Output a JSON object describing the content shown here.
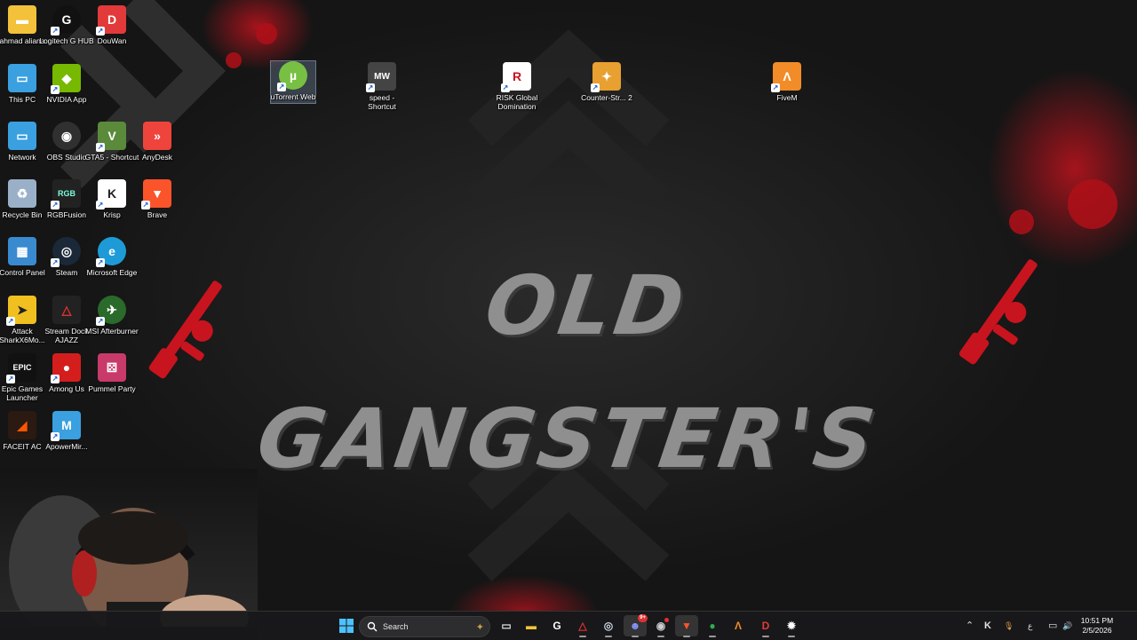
{
  "wallpaper": {
    "title": "OLD GANGSTER'S"
  },
  "desktop_icons": [
    {
      "label": "ahmad aliana",
      "icon": "folder-icon",
      "color": "#f3c13a"
    },
    {
      "label": "Logitech G HUB",
      "icon": "logitech-g-icon",
      "color": "#111111"
    },
    {
      "label": "DouWan",
      "icon": "douwan-icon",
      "color": "#e23a3a"
    },
    {
      "label": "This PC",
      "icon": "this-pc-icon",
      "color": "#3aa0e0"
    },
    {
      "label": "NVIDIA App",
      "icon": "nvidia-icon",
      "color": "#76b900"
    },
    {
      "label": "Network",
      "icon": "network-icon",
      "color": "#3aa0e0"
    },
    {
      "label": "OBS Studio",
      "icon": "obs-icon",
      "color": "#303030"
    },
    {
      "label": "GTA5 - Shortcut",
      "icon": "gta5-icon",
      "color": "#5a8a3a"
    },
    {
      "label": "AnyDesk",
      "icon": "anydesk-icon",
      "color": "#ef443b"
    },
    {
      "label": "Recycle Bin",
      "icon": "recycle-bin-icon",
      "color": "#9ab0c8"
    },
    {
      "label": "RGBFusion",
      "icon": "rgbfusion-icon",
      "color": "#222222"
    },
    {
      "label": "Krisp",
      "icon": "krisp-icon",
      "color": "#ffffff"
    },
    {
      "label": "Brave",
      "icon": "brave-icon",
      "color": "#fb542b"
    },
    {
      "label": "Control Panel",
      "icon": "control-panel-icon",
      "color": "#3a8ad0"
    },
    {
      "label": "Steam",
      "icon": "steam-icon",
      "color": "#1b2838"
    },
    {
      "label": "Microsoft Edge",
      "icon": "edge-icon",
      "color": "#1e9bd7"
    },
    {
      "label": "Attack SharkX6Mo...",
      "icon": "attack-shark-icon",
      "color": "#f0c020"
    },
    {
      "label": "Stream Dock AJAZZ",
      "icon": "stream-dock-icon",
      "color": "#222222"
    },
    {
      "label": "MSI Afterburner",
      "icon": "msi-afterburner-icon",
      "color": "#2a6a2a"
    },
    {
      "label": "Epic Games Launcher",
      "icon": "epic-games-icon",
      "color": "#111111"
    },
    {
      "label": "Among Us",
      "icon": "among-us-icon",
      "color": "#d41e1e"
    },
    {
      "label": "Pummel Party",
      "icon": "pummel-party-icon",
      "color": "#c83a6a"
    },
    {
      "label": "FACEIT AC",
      "icon": "faceit-icon",
      "color": "#ff5500"
    },
    {
      "label": "ApowerMir...",
      "icon": "apowermirror-icon",
      "color": "#3aa0e0"
    },
    {
      "label": "uTorrent Web",
      "icon": "utorrent-icon",
      "color": "#78c043"
    },
    {
      "label": "speed - Shortcut",
      "icon": "nfs-mw-icon",
      "color": "#444444"
    },
    {
      "label": "RISK Global Domination",
      "icon": "risk-icon",
      "color": "#ffffff"
    },
    {
      "label": "Counter-Str... 2",
      "icon": "counter-strike-icon",
      "color": "#e8a030"
    },
    {
      "label": "FiveM",
      "icon": "fivem-icon",
      "color": "#f28c28"
    }
  ],
  "icon_glyphs": [
    "▬",
    "G",
    "D",
    "▭",
    "◆",
    "▭",
    "◉",
    "V",
    "»",
    "♻",
    "RGB",
    "K",
    "▼",
    "▦",
    "◎",
    "e",
    "➤",
    "△",
    "✈",
    "EPIC",
    "●",
    "⚄",
    "◢",
    "M",
    "µ",
    "MW",
    "R",
    "✦",
    "Λ"
  ],
  "taskbar": {
    "search_placeholder": "Search",
    "apps": [
      {
        "name": "task-view",
        "glyph": "▭",
        "color": "#dddddd"
      },
      {
        "name": "file-explorer",
        "glyph": "▬",
        "color": "#f3c13a"
      },
      {
        "name": "logitech-g-hub",
        "glyph": "G",
        "color": "#ffffff"
      },
      {
        "name": "stream-dock",
        "glyph": "△",
        "color": "#e03030"
      },
      {
        "name": "steam",
        "glyph": "◎",
        "color": "#c7d5e0"
      },
      {
        "name": "discord",
        "glyph": "☻",
        "color": "#5865f2",
        "badge": "9+"
      },
      {
        "name": "obs-studio",
        "glyph": "◉",
        "color": "#cccccc"
      },
      {
        "name": "brave",
        "glyph": "▼",
        "color": "#fb542b"
      },
      {
        "name": "chrome",
        "glyph": "●",
        "color": "#34a853"
      },
      {
        "name": "fivem",
        "glyph": "Λ",
        "color": "#f28c28"
      },
      {
        "name": "douwan",
        "glyph": "D",
        "color": "#e23a3a"
      },
      {
        "name": "steelseries",
        "glyph": "✹",
        "color": "#ffffff"
      }
    ],
    "tray": {
      "chevron": "⌃",
      "krisp": "K",
      "mic": "🎙",
      "language": "ع",
      "network": "▭",
      "volume": "🔊",
      "time": "10:51 PM",
      "date": "2/5/2026"
    }
  },
  "colors": {
    "accent_red": "#c8141e",
    "taskbar_bg": "#18181a"
  }
}
